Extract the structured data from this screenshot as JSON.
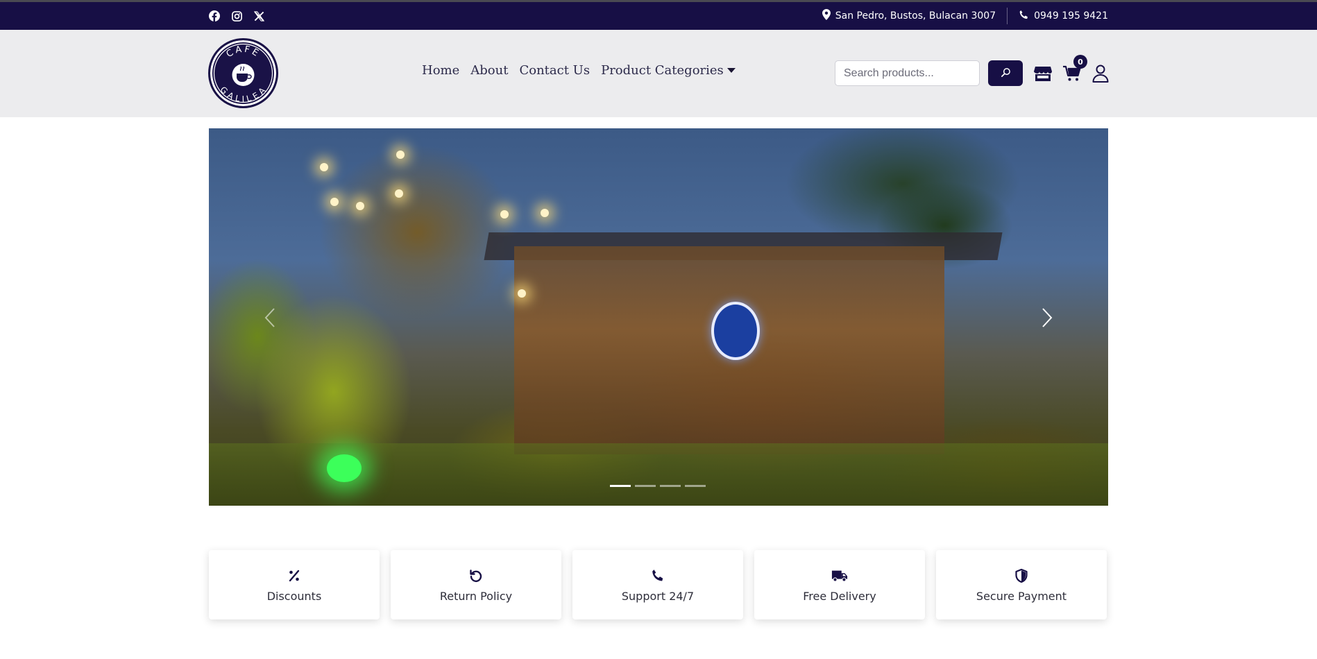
{
  "topbar": {
    "social": [
      {
        "icon": "facebook-icon"
      },
      {
        "icon": "instagram-icon"
      },
      {
        "icon": "x-twitter-icon"
      }
    ],
    "address": "San Pedro, Bustos, Bulacan 3007",
    "phone": "0949 195 9421"
  },
  "header": {
    "logo_text": "CAFE GALILEA",
    "nav": [
      "Home",
      "About",
      "Contact Us",
      "Product Categories"
    ],
    "search": {
      "placeholder": "Search products..."
    },
    "cart_count": "0"
  },
  "hero": {
    "slides": 4,
    "active_slide": 1
  },
  "features": [
    {
      "icon": "percent-icon",
      "label": "Discounts"
    },
    {
      "icon": "undo-icon",
      "label": "Return Policy"
    },
    {
      "icon": "phone-icon",
      "label": "Support 24/7"
    },
    {
      "icon": "truck-icon",
      "label": "Free Delivery"
    },
    {
      "icon": "shield-icon",
      "label": "Secure Payment"
    }
  ],
  "colors": {
    "brand_navy": "#170f45",
    "header_bg": "#ececee"
  }
}
